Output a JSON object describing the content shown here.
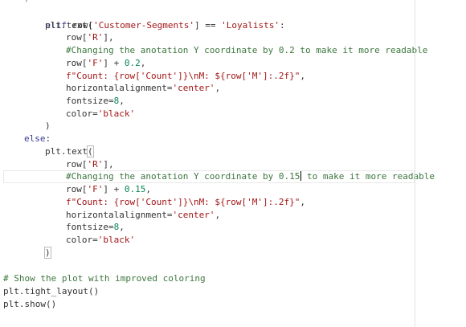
{
  "code": {
    "top_fragment": ")",
    "lines": [
      {
        "text": "elif row['Customer-Segments'] == 'Loyalists':"
      },
      {
        "text": "plt.text("
      },
      {
        "text": "row['R'],"
      },
      {
        "text": "#Changing the anotation Y coordinate by 0.2 to make it more readable"
      },
      {
        "text": "row['F'] + 0.2,"
      },
      {
        "text": "f\"Count: {row['Count']}\\nM: ${row['M']:.2f}\","
      },
      {
        "text": "horizontalalignment='center',"
      },
      {
        "text": "fontsize=8,"
      },
      {
        "text": "color='black'"
      },
      {
        "text": ")"
      },
      {
        "text": "else:"
      },
      {
        "text": "plt.text("
      },
      {
        "text": "row['R'],"
      },
      {
        "text": "#Changing the anotation Y coordinate by 0.15 to make it more readable"
      },
      {
        "text": "row['F'] + 0.15,"
      },
      {
        "text": "f\"Count: {row['Count']}\\nM: ${row['M']:.2f}\","
      },
      {
        "text": "horizontalalignment='center',"
      },
      {
        "text": "fontsize=8,"
      },
      {
        "text": "color='black'"
      },
      {
        "text": ")"
      },
      {
        "text": ""
      },
      {
        "text": "# Show the plot with improved coloring"
      },
      {
        "text": "plt.tight_layout()"
      },
      {
        "text": "plt.show()"
      }
    ]
  }
}
